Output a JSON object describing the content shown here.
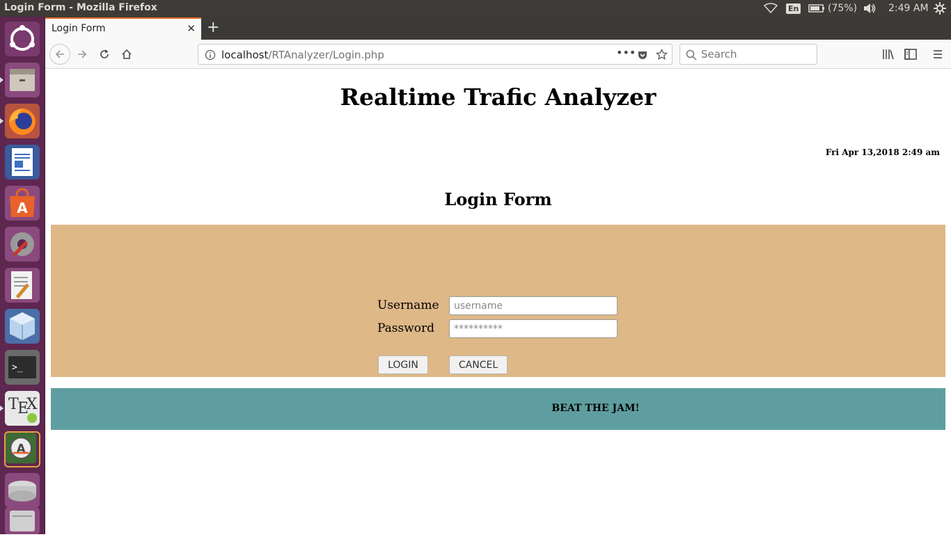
{
  "system": {
    "window_title": "Login Form - Mozilla Firefox",
    "language": "En",
    "battery": "(75%)",
    "clock": "2:49 AM"
  },
  "launcher": {
    "items": [
      "ubuntu-dash",
      "files",
      "firefox",
      "libreoffice-writer",
      "software-center",
      "system-settings",
      "text-editor",
      "virtualbox",
      "terminal",
      "texmaker",
      "software-updater",
      "disks"
    ]
  },
  "browser": {
    "tab_title": "Login Form",
    "url_host": "localhost",
    "url_path": "/RTAnalyzer/Login.php",
    "search_placeholder": "Search",
    "accent": "#e8682a"
  },
  "page": {
    "site_title": "Realtime Trafic Analyzer",
    "date_time": "Fri Apr 13,2018 2:49 am",
    "form_heading": "Login Form",
    "username_label": "Username",
    "username_placeholder": "username",
    "password_label": "Password",
    "password_placeholder": "**********",
    "login_button": "LOGIN",
    "cancel_button": "CANCEL",
    "footer_text": "BEAT THE JAM!",
    "form_bg": "#deb887",
    "footer_bg": "#5f9ea0"
  }
}
